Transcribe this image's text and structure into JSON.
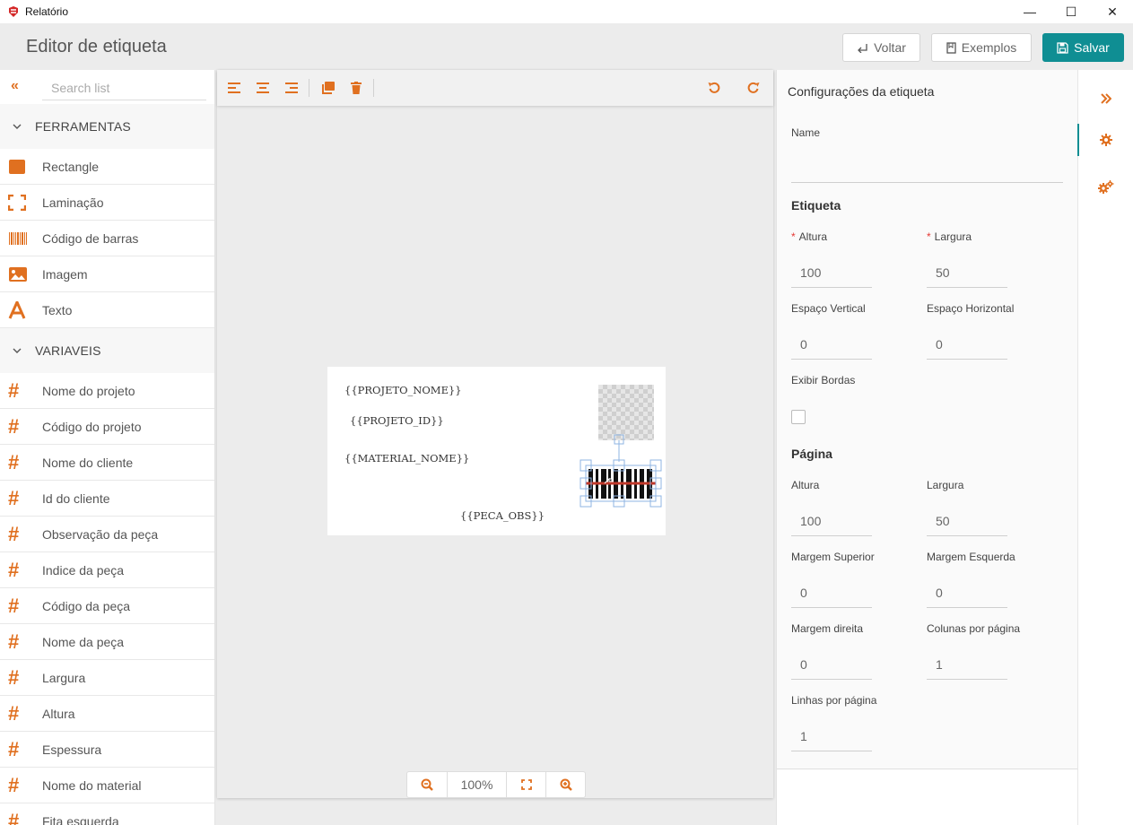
{
  "window": {
    "title": "Relatório",
    "minimize": "—",
    "maximize": "☐",
    "close": "✕"
  },
  "header": {
    "page_title": "Editor de etiqueta",
    "back_label": "Voltar",
    "examples_label": "Exemplos",
    "save_label": "Salvar"
  },
  "sidebar": {
    "search_placeholder": "Search list",
    "tools_section": "FERRAMENTAS",
    "tools": [
      {
        "label": "Rectangle",
        "icon": "rectangle-icon"
      },
      {
        "label": "Laminação",
        "icon": "lamination-icon"
      },
      {
        "label": "Código de barras",
        "icon": "barcode-icon"
      },
      {
        "label": "Imagem",
        "icon": "image-icon"
      },
      {
        "label": "Texto",
        "icon": "text-icon"
      }
    ],
    "vars_section": "VARIAVEIS",
    "variables": [
      "Nome do projeto",
      "Código do projeto",
      "Nome do cliente",
      "Id do cliente",
      "Observação da peça",
      "Indice da peça",
      "Código da peça",
      "Nome da peça",
      "Largura",
      "Altura",
      "Espessura",
      "Nome do material",
      "Fita esquerda"
    ]
  },
  "canvas": {
    "texts": {
      "projeto_nome": "{{PROJETO_NOME}}",
      "projeto_id": "{{PROJETO_ID}}",
      "material_nome": "{{MATERIAL_NOME}}",
      "peca_obs": "{{PECA_OBS}}"
    },
    "zoom": "100%"
  },
  "props": {
    "title": "Configurações da etiqueta",
    "name_label": "Name",
    "name_value": "",
    "etiqueta_title": "Etiqueta",
    "altura_label": "Altura",
    "altura_value": "100",
    "largura_label": "Largura",
    "largura_value": "50",
    "esp_vertical_label": "Espaço Vertical",
    "esp_vertical_value": "0",
    "esp_horizontal_label": "Espaço Horizontal",
    "esp_horizontal_value": "0",
    "exibir_bordas_label": "Exibir Bordas",
    "pagina_title": "Página",
    "pg_altura_label": "Altura",
    "pg_altura_value": "100",
    "pg_largura_label": "Largura",
    "pg_largura_value": "50",
    "margem_superior_label": "Margem Superior",
    "margem_superior_value": "0",
    "margem_esquerda_label": "Margem Esquerda",
    "margem_esquerda_value": "0",
    "margem_direita_label": "Margem direita",
    "margem_direita_value": "0",
    "colunas_label": "Colunas por página",
    "colunas_value": "1",
    "linhas_label": "Linhas por página",
    "linhas_value": "1",
    "required_mark": "*"
  },
  "colors": {
    "accent": "#e07020",
    "primary": "#0f8e93"
  }
}
